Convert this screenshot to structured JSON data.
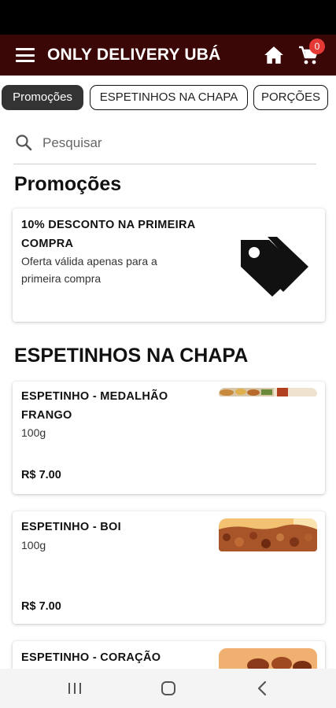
{
  "app": {
    "title": "ONLY DELIVERY UBÁ",
    "cart_count": "0"
  },
  "tabs": [
    {
      "label": "Promoções",
      "active": true
    },
    {
      "label": "ESPETINHOS NA CHAPA",
      "active": false
    },
    {
      "label": "PORÇÕES",
      "active": false
    }
  ],
  "search": {
    "placeholder": "Pesquisar"
  },
  "sections": {
    "promotions": {
      "title": "Promoções",
      "items": [
        {
          "title": "10% DESCONTO NA PRIMEIRA COMPRA",
          "description": "Oferta válida apenas para a primeira compra",
          "icon": "price-tag-icon"
        }
      ]
    },
    "espetinhos": {
      "title": "ESPETINHOS NA CHAPA",
      "items": [
        {
          "title": "ESPETINHO - MEDALHÃO FRANGO",
          "description": "100g",
          "price": "R$ 7.00"
        },
        {
          "title": "ESPETINHO - BOI",
          "description": "100g",
          "price": "R$ 7.00"
        },
        {
          "title": "ESPETINHO - CORAÇÃO"
        }
      ]
    }
  },
  "colors": {
    "app_bar": "#3a0606",
    "badge": "#e53935",
    "active_tab": "#333333",
    "nav_bar": "#f4f4f4"
  }
}
